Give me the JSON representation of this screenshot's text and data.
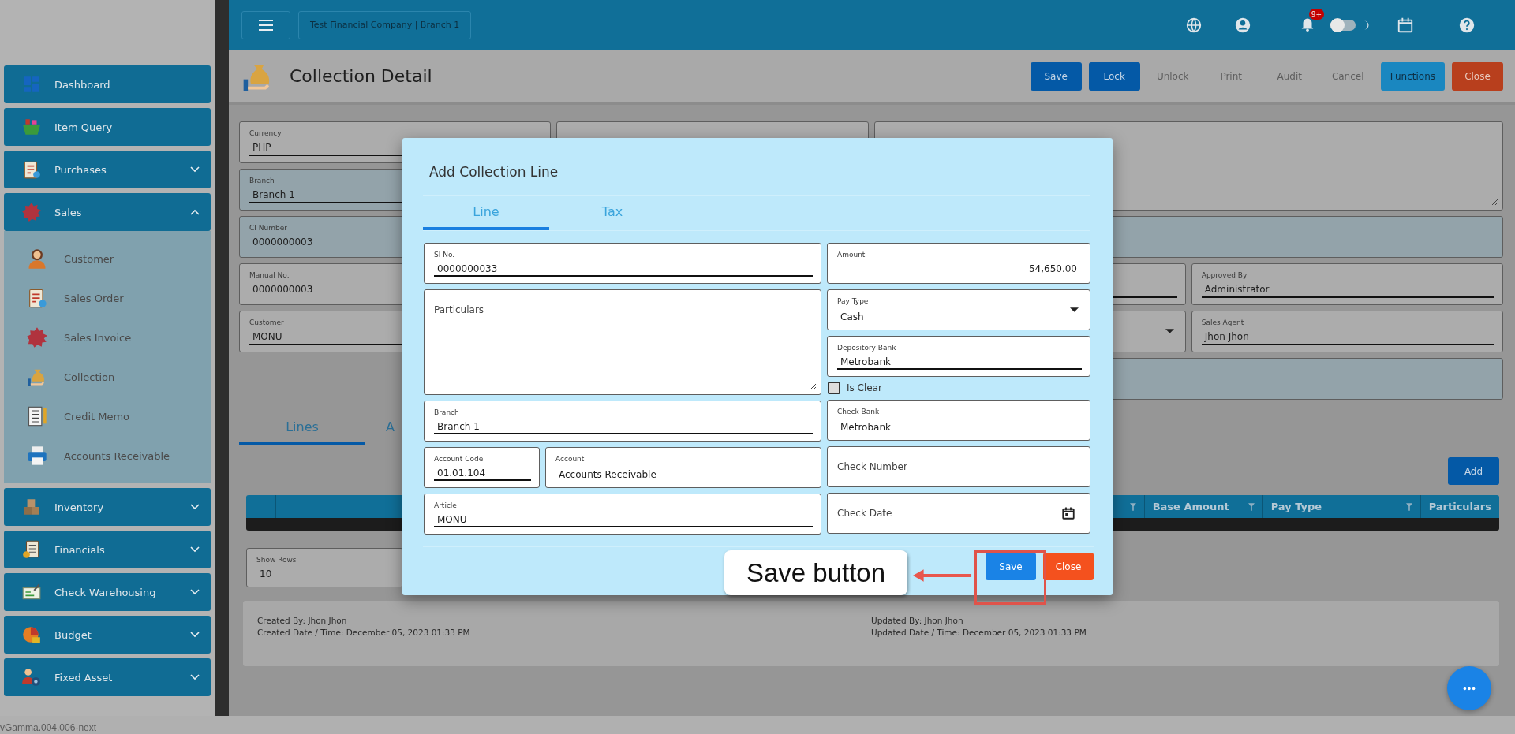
{
  "sidebar": {
    "items": [
      {
        "label": "Dashboard",
        "kind": "link"
      },
      {
        "label": "Item Query",
        "kind": "link"
      },
      {
        "label": "Purchases",
        "kind": "group",
        "expanded": false
      },
      {
        "label": "Sales",
        "kind": "group",
        "expanded": true,
        "children": [
          {
            "label": "Customer"
          },
          {
            "label": "Sales Order"
          },
          {
            "label": "Sales Invoice"
          },
          {
            "label": "Collection"
          },
          {
            "label": "Credit Memo"
          },
          {
            "label": "Accounts Receivable"
          }
        ]
      },
      {
        "label": "Inventory",
        "kind": "group",
        "expanded": false
      },
      {
        "label": "Financials",
        "kind": "group",
        "expanded": false
      },
      {
        "label": "Check Warehousing",
        "kind": "group",
        "expanded": false
      },
      {
        "label": "Budget",
        "kind": "group",
        "expanded": false
      },
      {
        "label": "Fixed Asset",
        "kind": "group",
        "expanded": false
      }
    ]
  },
  "topbar": {
    "company": "Test Financial Company | Branch 1",
    "notification_badge": "9+",
    "dark_mode": false
  },
  "header": {
    "title": "Collection Detail",
    "buttons": [
      {
        "label": "Save",
        "kind": "primary",
        "disabled": false
      },
      {
        "label": "Lock",
        "kind": "primary",
        "disabled": false
      },
      {
        "label": "Unlock",
        "kind": "flat",
        "disabled": true
      },
      {
        "label": "Print",
        "kind": "flat",
        "disabled": true
      },
      {
        "label": "Audit",
        "kind": "flat",
        "disabled": true
      },
      {
        "label": "Cancel",
        "kind": "flat",
        "disabled": true
      },
      {
        "label": "Functions",
        "kind": "info",
        "disabled": false
      },
      {
        "label": "Close",
        "kind": "danger",
        "disabled": false
      }
    ]
  },
  "form": {
    "fields": [
      {
        "kind": "input",
        "label": "Currency",
        "value": "PHP",
        "disabled": false
      },
      {
        "kind": "plain",
        "disabled": false
      },
      {
        "kind": "textarea",
        "disabled": false
      },
      {
        "kind": "input",
        "label": "Branch",
        "value": "Branch 1",
        "disabled": true
      },
      {
        "kind": "plain",
        "label": "CI Number",
        "value": "0000000003",
        "disabled": true
      },
      {
        "kind": "plain",
        "disabled": true
      },
      {
        "kind": "plain",
        "label": "Manual No.",
        "value": "0000000003",
        "disabled": false
      },
      {
        "kind": "input",
        "disabled": false
      },
      {
        "kind": "input",
        "label": "Approved By",
        "value": "Administrator",
        "disabled": false
      },
      {
        "kind": "input",
        "label": "Customer",
        "value": "MONU",
        "disabled": false
      },
      {
        "kind": "select",
        "disabled": false
      },
      {
        "kind": "input",
        "label": "Sales Agent",
        "value": "Jhon Jhon",
        "disabled": false
      },
      {
        "kind": "plain",
        "disabled": true
      }
    ]
  },
  "tabs": [
    {
      "label": "Lines",
      "selected": true
    },
    {
      "label": "A",
      "selected": false
    }
  ],
  "add_button": "Add",
  "table": {
    "columns": [
      {
        "filter": false
      },
      {
        "filter": false
      },
      {
        "filter": false
      },
      {
        "filter": true
      },
      {
        "label": "Base Amount",
        "filter": true
      },
      {
        "label": "Pay Type",
        "filter": true
      },
      {
        "label": "Particulars",
        "filter": false
      }
    ]
  },
  "show_rows": {
    "label": "Show Rows",
    "value": "10"
  },
  "audit": {
    "created_by": "Created By: Jhon Jhon",
    "created_date": "Created Date / Time: December 05, 2023 01:33 PM",
    "updated_by": "Updated By: Jhon Jhon",
    "updated_date": "Updated Date / Time: December 05, 2023 01:33 PM"
  },
  "modal": {
    "title": "Add Collection Line",
    "tabs": [
      {
        "label": "Line",
        "selected": true
      },
      {
        "label": "Tax",
        "selected": false
      }
    ],
    "left": [
      {
        "kind": "input",
        "label": "SI No.",
        "value": "0000000033"
      },
      {
        "kind": "textarea",
        "placeholder": "Particulars"
      },
      {
        "kind": "input",
        "label": "Branch",
        "value": "Branch 1"
      },
      {
        "kind": "pair",
        "fields": [
          {
            "kind": "input",
            "label": "Account Code",
            "value": "01.01.104"
          },
          {
            "kind": "plain",
            "label": "Account",
            "value": "Accounts Receivable"
          }
        ]
      },
      {
        "kind": "input",
        "label": "Article",
        "value": "MONU"
      }
    ],
    "right": [
      {
        "kind": "number",
        "label": "Amount",
        "value": "54,650.00"
      },
      {
        "kind": "select",
        "label": "Pay Type",
        "value": "Cash"
      },
      {
        "kind": "input",
        "label": "Depository Bank",
        "value": "Metrobank"
      },
      {
        "kind": "checkbox",
        "label": "Is Clear",
        "checked": false
      },
      {
        "kind": "plain",
        "label": "Check Bank",
        "value": "Metrobank"
      },
      {
        "kind": "plain",
        "placeholder": "Check Number"
      },
      {
        "kind": "date",
        "placeholder": "Check Date"
      }
    ],
    "buttons": [
      {
        "label": "Save",
        "kind": "primary"
      },
      {
        "label": "Close",
        "kind": "danger"
      }
    ]
  },
  "annotation": {
    "text": "Save button"
  },
  "version": "vGamma.004.006-next"
}
